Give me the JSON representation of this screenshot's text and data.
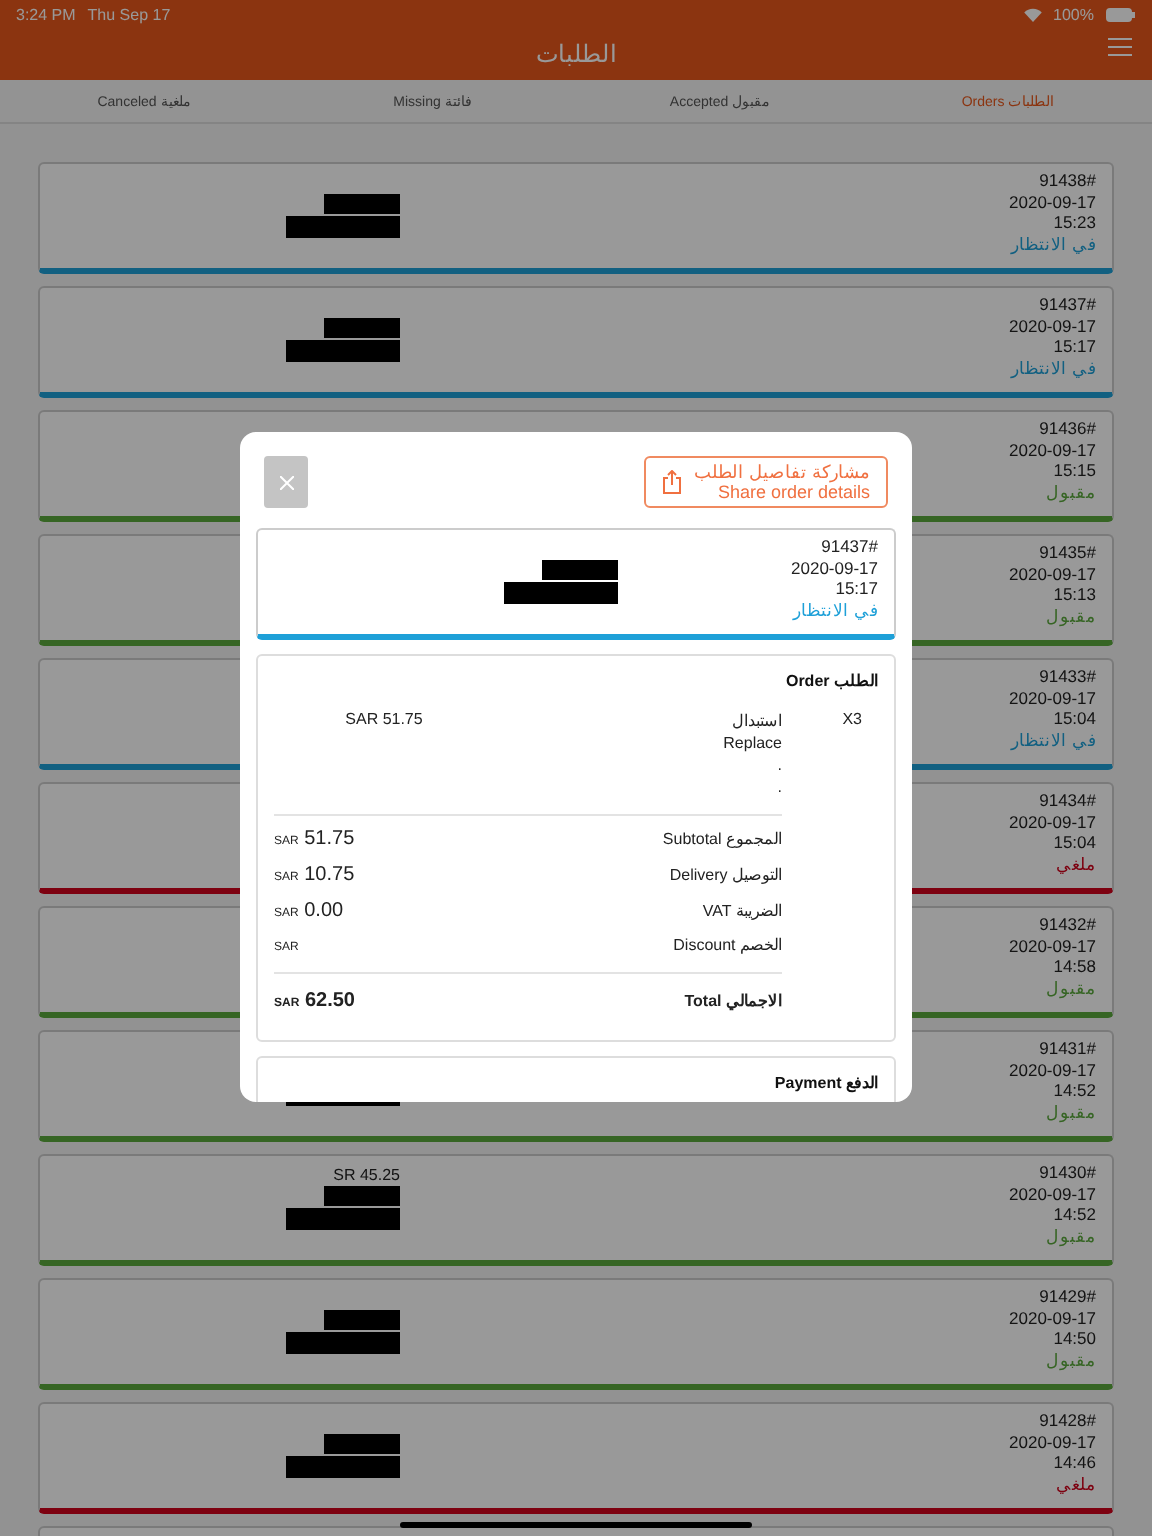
{
  "status_bar": {
    "time": "3:24 PM",
    "date": "Thu Sep 17",
    "battery": "100%"
  },
  "header": {
    "title": "الطلبات"
  },
  "tabs": [
    {
      "label": "الطلبات Orders",
      "selected": true
    },
    {
      "label": "مقبول Accepted",
      "selected": false
    },
    {
      "label": "فائتة Missing",
      "selected": false
    },
    {
      "label": "ملغية Canceled",
      "selected": false
    }
  ],
  "orders": [
    {
      "number": "91438#",
      "date": "2020-09-17",
      "time": "15:23",
      "status": "في الانتظار",
      "kind": "pending"
    },
    {
      "number": "91437#",
      "date": "2020-09-17",
      "time": "15:17",
      "status": "في الانتظار",
      "kind": "pending"
    },
    {
      "number": "91436#",
      "date": "2020-09-17",
      "time": "15:15",
      "status": "مقبول",
      "kind": "accepted"
    },
    {
      "number": "91435#",
      "date": "2020-09-17",
      "time": "15:13",
      "status": "مقبول",
      "kind": "accepted"
    },
    {
      "number": "91433#",
      "date": "2020-09-17",
      "time": "15:04",
      "status": "في الانتظار",
      "kind": "pending"
    },
    {
      "number": "91434#",
      "date": "2020-09-17",
      "time": "15:04",
      "status": "ملغي",
      "kind": "canceled"
    },
    {
      "number": "91432#",
      "date": "2020-09-17",
      "time": "14:58",
      "status": "مقبول",
      "kind": "accepted"
    },
    {
      "number": "91431#",
      "date": "2020-09-17",
      "time": "14:52",
      "status": "مقبول",
      "kind": "accepted"
    },
    {
      "number": "91430#",
      "date": "2020-09-17",
      "time": "14:52",
      "status": "مقبول",
      "kind": "accepted",
      "amount": "SR 45.25"
    },
    {
      "number": "91429#",
      "date": "2020-09-17",
      "time": "14:50",
      "status": "مقبول",
      "kind": "accepted"
    },
    {
      "number": "91428#",
      "date": "2020-09-17",
      "time": "14:46",
      "status": "ملغي",
      "kind": "canceled"
    }
  ],
  "modal": {
    "share_button": [
      "مشاركة تفاصيل الطلب",
      "Share order details"
    ],
    "order": {
      "number": "91437#",
      "date": "2020-09-17",
      "time": "15:17",
      "status": "في الانتظار",
      "kind": "pending"
    },
    "order_section": {
      "title": "الطلب Order",
      "items": [
        {
          "qty": "X3",
          "name_lines": [
            "استبدال",
            "Replace",
            ".",
            "."
          ],
          "price": "SAR 51.75"
        }
      ],
      "summary": [
        {
          "label": "المجموع Subtotal",
          "currency": "SAR",
          "amount": "51.75"
        },
        {
          "label": "التوصيل Delivery",
          "currency": "SAR",
          "amount": "10.75"
        },
        {
          "label": "الضريبة VAT",
          "currency": "SAR",
          "amount": "0.00"
        },
        {
          "label": "الخصم Discount",
          "currency": "SAR"
        }
      ],
      "total": {
        "label": "الاجمالي Total",
        "currency": "SAR",
        "amount": "62.50"
      }
    },
    "payment_section": {
      "title": "الدفع Payment"
    }
  }
}
